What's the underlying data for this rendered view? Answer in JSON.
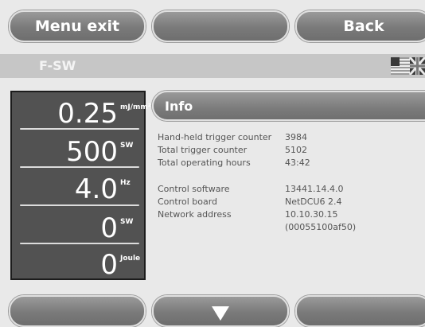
{
  "topbar": {
    "menu_exit_label": "Menu exit",
    "middle_label": "",
    "back_label": "Back"
  },
  "titlebar": {
    "title": "F-SW",
    "language_flag": "uk-us-flag-icon"
  },
  "parameters": [
    {
      "value": "0.25",
      "unit": "mJ/mm²"
    },
    {
      "value": "500",
      "unit": "SW"
    },
    {
      "value": "4.0",
      "unit": "Hz"
    },
    {
      "value": "0",
      "unit": "SW"
    },
    {
      "value": "0",
      "unit": "Joule"
    }
  ],
  "info": {
    "title": "Info",
    "rows": [
      {
        "label": "Hand-held trigger counter",
        "value": "3984"
      },
      {
        "label": "Total trigger counter",
        "value": "5102"
      },
      {
        "label": "Total operating hours",
        "value": "43:42"
      },
      {
        "label": "Control software",
        "value": "13441.14.4.0"
      },
      {
        "label": "Control board",
        "value": "NetDCU6 2.4"
      },
      {
        "label": "Network address",
        "value": "10.10.30.15"
      },
      {
        "label": "",
        "value": "(00055100af50)"
      }
    ]
  },
  "bottombar": {
    "left_label": "",
    "middle_icon": "down-arrow-icon",
    "right_label": ""
  },
  "colors": {
    "button_fill": "#7a7a7a",
    "panel_fill": "#525252",
    "titlebar": "#c6c6c6",
    "background": "#e9e9e9"
  }
}
